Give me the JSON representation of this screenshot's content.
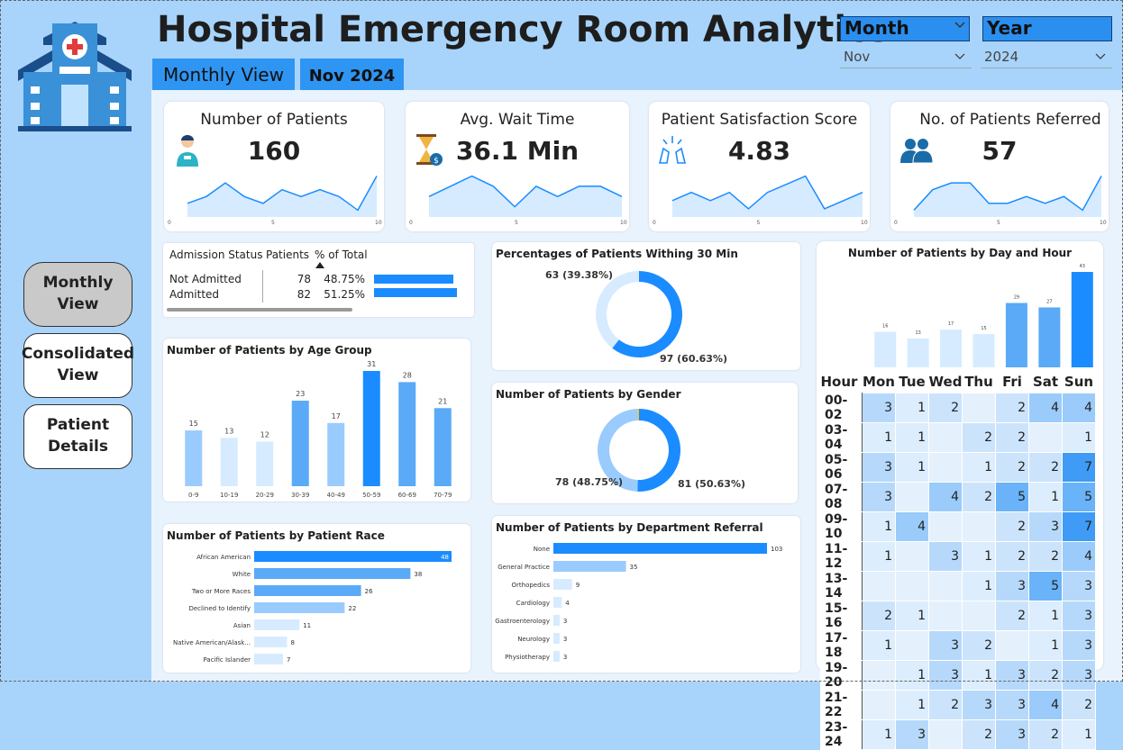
{
  "header": {
    "title": "Hospital Emergency Room Analytics",
    "view_tab": "Monthly View",
    "period_tab": "Nov 2024",
    "month_slicer": {
      "label": "Month",
      "value": "Nov"
    },
    "year_slicer": {
      "label": "Year",
      "value": "2024"
    }
  },
  "sidebar": {
    "buttons": [
      {
        "label": "Monthly View"
      },
      {
        "label": "Consolidated View"
      },
      {
        "label": "Patient Details"
      }
    ]
  },
  "kpis": [
    {
      "title": "Number of Patients",
      "value": "160",
      "icon": "person-icon",
      "spark": [
        2,
        3,
        5,
        3,
        2,
        4,
        3,
        4,
        3,
        1,
        6
      ],
      "axis": [
        "0",
        "5",
        "10"
      ]
    },
    {
      "title": "Avg. Wait Time",
      "value": "36.1 Min",
      "icon": "hourglass-icon",
      "spark": [
        2,
        3,
        4,
        3,
        1,
        3,
        2,
        3,
        3,
        2
      ],
      "axis": [
        "0",
        "5",
        "10"
      ]
    },
    {
      "title": "Patient Satisfaction Score",
      "value": "4.83",
      "icon": "applause-icon",
      "spark": [
        2,
        3,
        2,
        3,
        1,
        3,
        4,
        5,
        1,
        2,
        3
      ],
      "axis": [
        "0",
        "5",
        "10"
      ]
    },
    {
      "title": "No. of Patients Referred",
      "value": "57",
      "icon": "people-icon",
      "spark": [
        1,
        4,
        5,
        5,
        2,
        2,
        3,
        2,
        3,
        1,
        6
      ],
      "axis": [
        "0",
        "5",
        "10"
      ]
    }
  ],
  "admission": {
    "headers": [
      "Admission Status",
      "Patients",
      "% of Total"
    ],
    "rows": [
      {
        "status": "Not Admitted",
        "patients": "78",
        "pct": "48.75%",
        "frac": 0.4875
      },
      {
        "status": "Admitted",
        "patients": "82",
        "pct": "51.25%",
        "frac": 0.5125
      }
    ]
  },
  "colors": {
    "accent": "#1a8cff",
    "light": "#99cbff",
    "lighter": "#d6ebff",
    "bg": "#a8d4fb"
  },
  "chart_data": [
    {
      "id": "age",
      "type": "bar",
      "title": "Number of Patients by Age Group",
      "categories": [
        "0-9",
        "10-19",
        "20-29",
        "30-39",
        "40-49",
        "50-59",
        "60-69",
        "70-79"
      ],
      "values": [
        15,
        13,
        12,
        23,
        17,
        31,
        28,
        21
      ]
    },
    {
      "id": "race",
      "type": "bar",
      "orientation": "horizontal",
      "title": "Number of Patients by Patient Race",
      "categories": [
        "African American",
        "White",
        "Two or More Races",
        "Declined to Identify",
        "Asian",
        "Native American/Alask...",
        "Pacific Islander"
      ],
      "values": [
        48,
        38,
        26,
        22,
        11,
        8,
        7
      ]
    },
    {
      "id": "within30",
      "type": "pie",
      "title": "Percentages of Patients Withing 30 Min",
      "slices": [
        {
          "label": "97 (60.63%)",
          "value": 97
        },
        {
          "label": "63 (39.38%)",
          "value": 63
        }
      ]
    },
    {
      "id": "gender",
      "type": "pie",
      "title": "Number of Patients by Gender",
      "slices": [
        {
          "label": "81 (50.63%)",
          "value": 81
        },
        {
          "label": "78 (48.75%)",
          "value": 78
        },
        {
          "label": "",
          "value": 1
        }
      ]
    },
    {
      "id": "dept",
      "type": "bar",
      "orientation": "horizontal",
      "title": "Number of Patients by Department Referral",
      "categories": [
        "None",
        "General Practice",
        "Orthopedics",
        "Cardiology",
        "Gastroenterology",
        "Neurology",
        "Physiotherapy"
      ],
      "values": [
        103,
        35,
        9,
        4,
        3,
        3,
        3
      ]
    },
    {
      "id": "day",
      "type": "bar",
      "title": "Number of Patients by Day and Hour",
      "categories": [
        "Mon",
        "Tue",
        "Wed",
        "Thu",
        "Fri",
        "Sat",
        "Sun"
      ],
      "values": [
        16,
        13,
        17,
        15,
        29,
        27,
        43
      ]
    },
    {
      "id": "heatmap",
      "type": "heatmap",
      "row_header": "Hour",
      "columns": [
        "Mon",
        "Tue",
        "Wed",
        "Thu",
        "Fri",
        "Sat",
        "Sun"
      ],
      "rows": [
        {
          "hour": "00-02",
          "cells": [
            3,
            1,
            2,
            null,
            2,
            4,
            4
          ]
        },
        {
          "hour": "03-04",
          "cells": [
            1,
            1,
            null,
            2,
            2,
            null,
            1
          ]
        },
        {
          "hour": "05-06",
          "cells": [
            3,
            1,
            null,
            1,
            2,
            2,
            7
          ]
        },
        {
          "hour": "07-08",
          "cells": [
            3,
            null,
            4,
            2,
            5,
            1,
            5
          ]
        },
        {
          "hour": "09-10",
          "cells": [
            1,
            4,
            null,
            null,
            2,
            3,
            7
          ]
        },
        {
          "hour": "11-12",
          "cells": [
            1,
            null,
            3,
            1,
            2,
            2,
            4
          ]
        },
        {
          "hour": "13-14",
          "cells": [
            null,
            null,
            null,
            1,
            3,
            5,
            3
          ]
        },
        {
          "hour": "15-16",
          "cells": [
            2,
            1,
            null,
            null,
            2,
            1,
            3
          ]
        },
        {
          "hour": "17-18",
          "cells": [
            1,
            null,
            3,
            2,
            null,
            1,
            3
          ]
        },
        {
          "hour": "19-20",
          "cells": [
            null,
            1,
            3,
            1,
            3,
            2,
            3
          ]
        },
        {
          "hour": "21-22",
          "cells": [
            null,
            1,
            2,
            3,
            3,
            4,
            2
          ]
        },
        {
          "hour": "23-24",
          "cells": [
            1,
            3,
            null,
            2,
            3,
            2,
            1
          ]
        }
      ]
    }
  ]
}
